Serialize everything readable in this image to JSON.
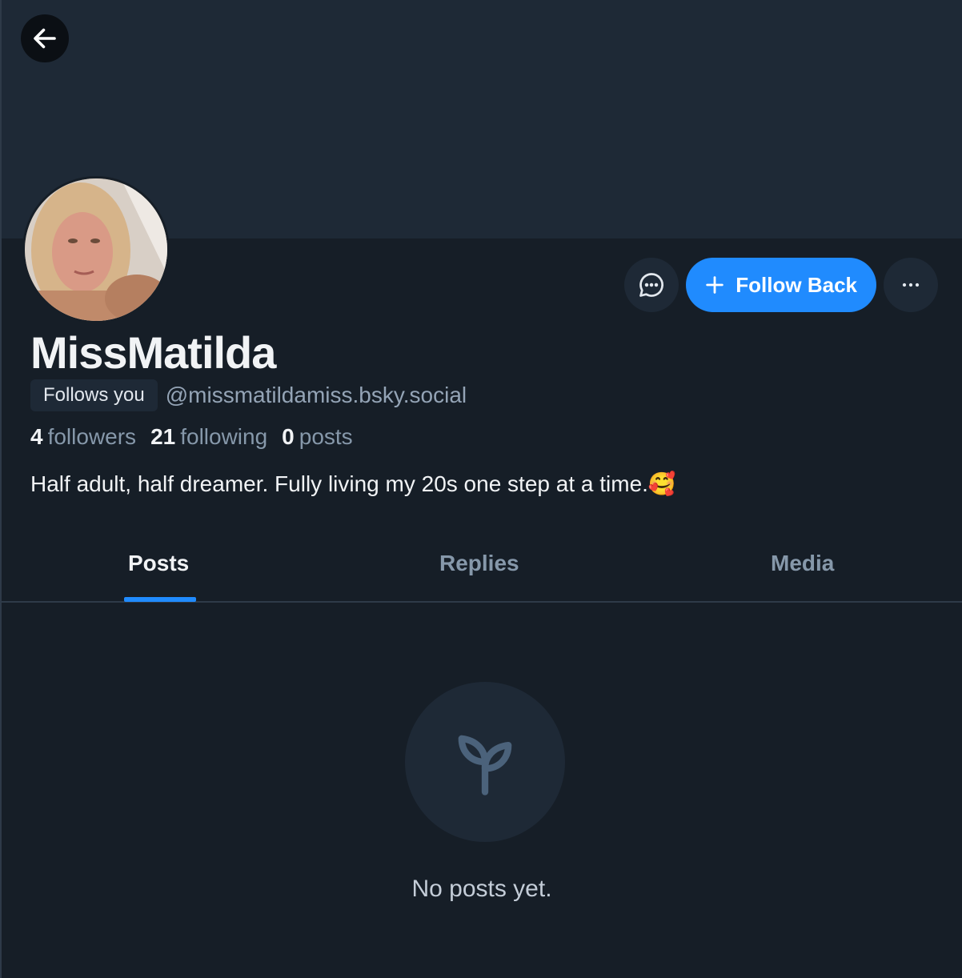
{
  "header": {
    "back_icon": "arrow-left-icon"
  },
  "profile": {
    "display_name": "MissMatilda",
    "follows_you_label": "Follows you",
    "handle": "@missmatildamiss.bsky.social",
    "stats": {
      "followers_count": "4",
      "followers_label": "followers",
      "following_count": "21",
      "following_label": "following",
      "posts_count": "0",
      "posts_label": "posts"
    },
    "bio": "Half adult, half dreamer. Fully living my 20s one step at a time.🥰"
  },
  "actions": {
    "message_icon": "chat-bubble-icon",
    "follow_back_label": "Follow Back",
    "more_icon": "more-horizontal-icon"
  },
  "tabs": [
    {
      "label": "Posts",
      "active": true
    },
    {
      "label": "Replies",
      "active": false
    },
    {
      "label": "Media",
      "active": false
    }
  ],
  "empty_state": {
    "icon": "seedling-icon",
    "message": "No posts yet."
  },
  "colors": {
    "accent": "#208bfe",
    "background": "#161e27",
    "banner": "#1e2936"
  }
}
